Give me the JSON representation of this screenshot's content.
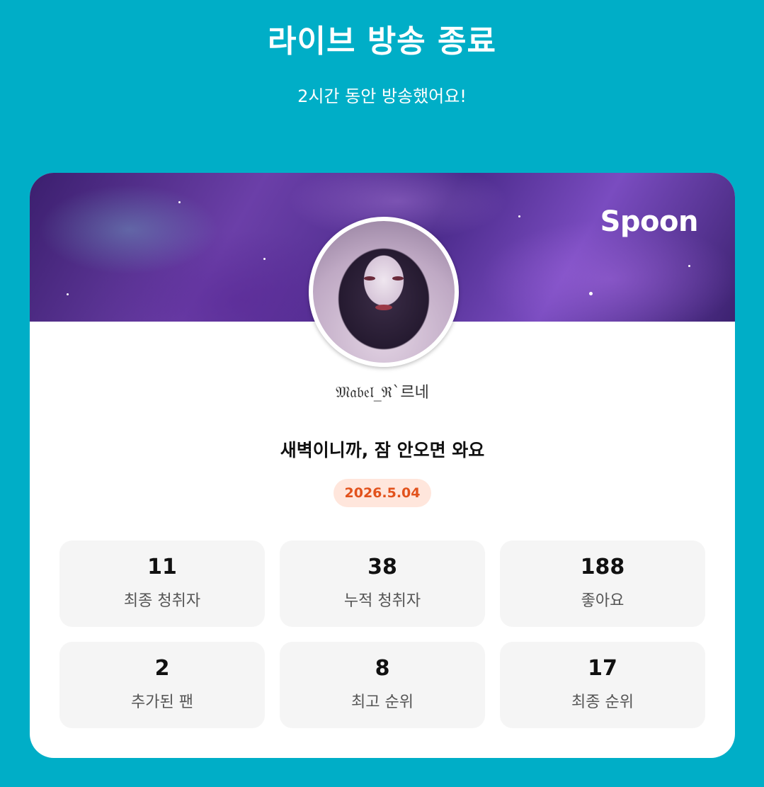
{
  "header": {
    "title": "라이브 방송 종료",
    "subtitle": "2시간 동안 방송했어요!"
  },
  "card": {
    "logo_text": "Spoon",
    "nickname": "𝔐𝔞𝔟𝔢𝔩_ℜ`르네",
    "room_title": "새벽이니까, 잠 안오면 와요",
    "date": "2026.5.04"
  },
  "stats": [
    {
      "value": "11",
      "label": "최종 청취자"
    },
    {
      "value": "38",
      "label": "누적 청취자"
    },
    {
      "value": "188",
      "label": "좋아요"
    },
    {
      "value": "2",
      "label": "추가된 팬"
    },
    {
      "value": "8",
      "label": "최고 순위"
    },
    {
      "value": "17",
      "label": "최종 순위"
    }
  ],
  "colors": {
    "background": "#00aec7",
    "date_text": "#e2521c",
    "date_badge": "#ffe6dc"
  }
}
